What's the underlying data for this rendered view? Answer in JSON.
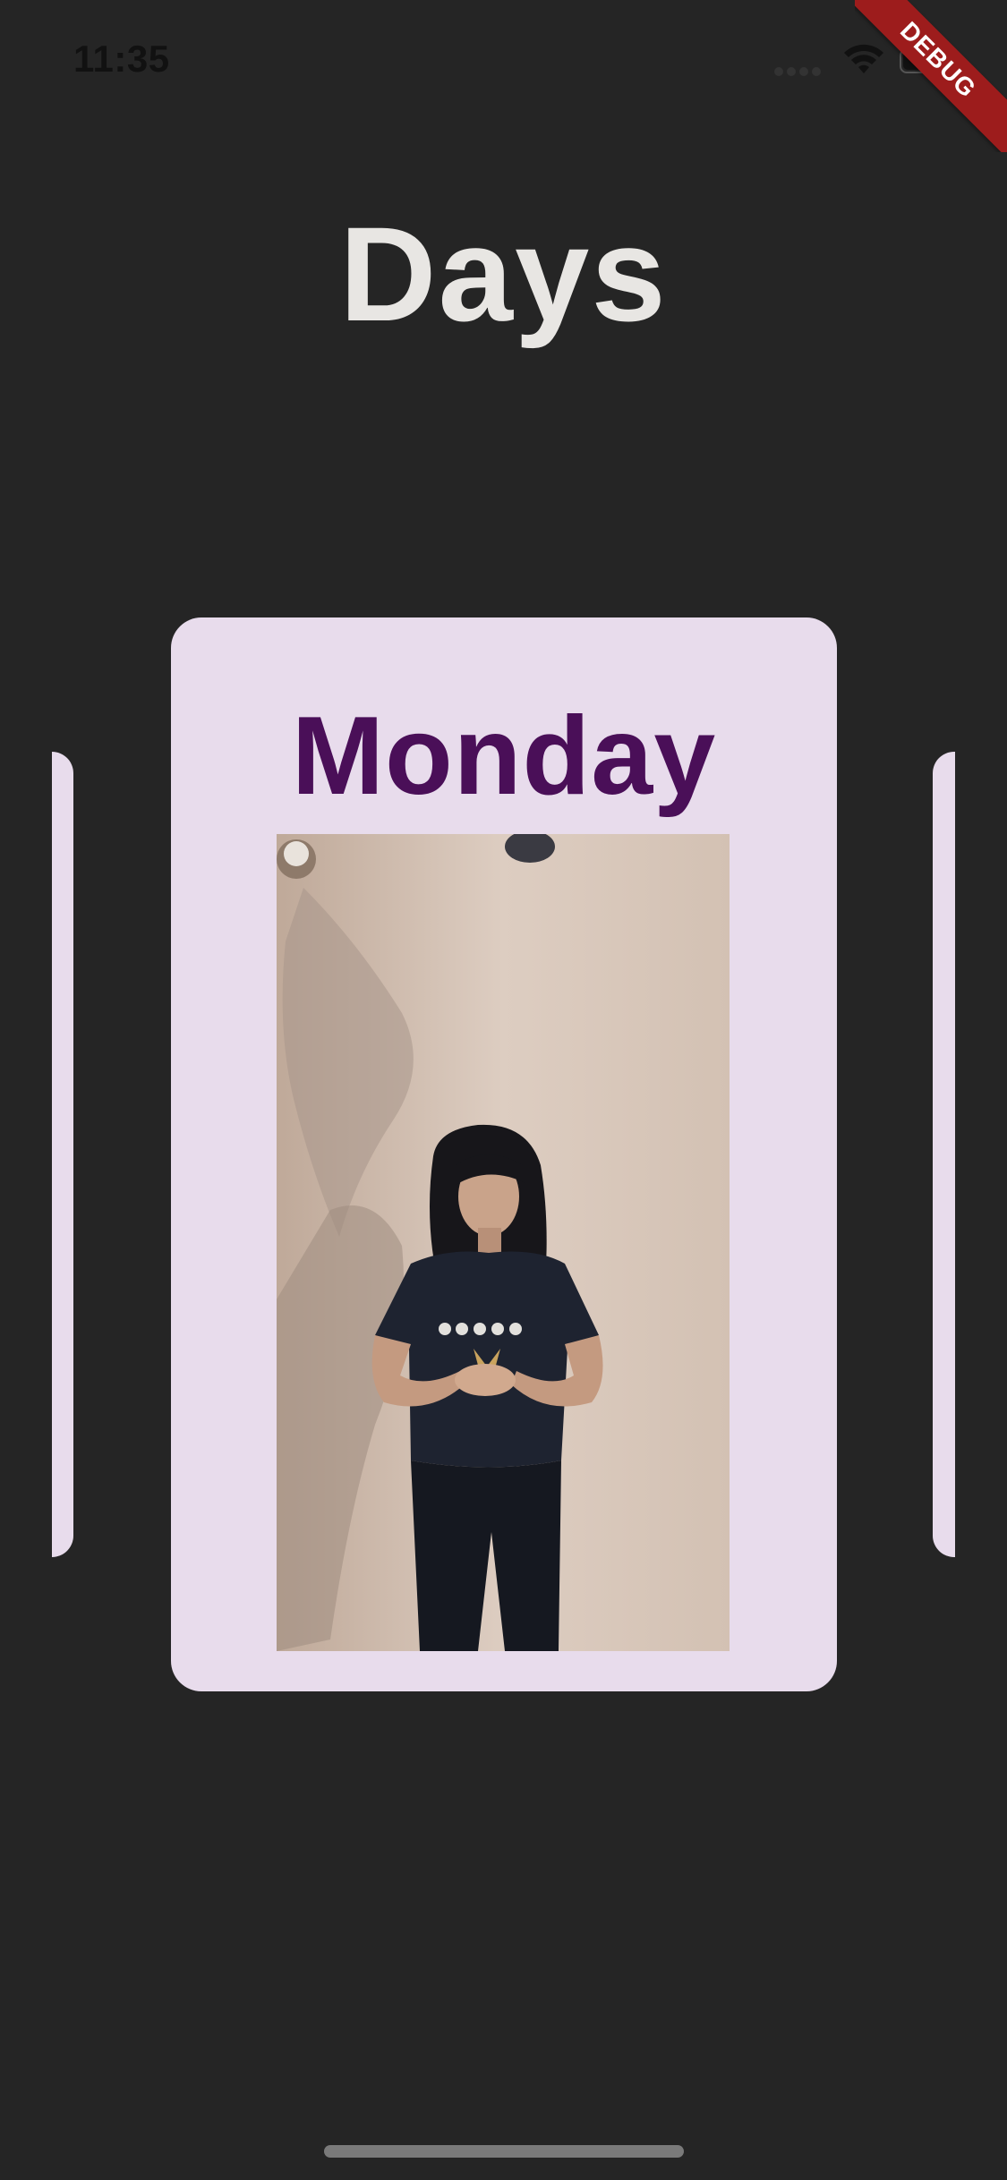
{
  "status_bar": {
    "time": "11:35"
  },
  "debug_banner": {
    "label": "DEBUG"
  },
  "header": {
    "title": "Days"
  },
  "carousel": {
    "current_card": {
      "label": "Monday",
      "media": "sign-language-video-woman"
    }
  },
  "colors": {
    "background": "#252525",
    "card": "#e8dcec",
    "card_label": "#4a0f58",
    "title": "#e8e6e3",
    "debug_ribbon": "#9d1c1c"
  },
  "icons": [
    "cellular-signal-icon",
    "wifi-icon",
    "battery-icon"
  ]
}
